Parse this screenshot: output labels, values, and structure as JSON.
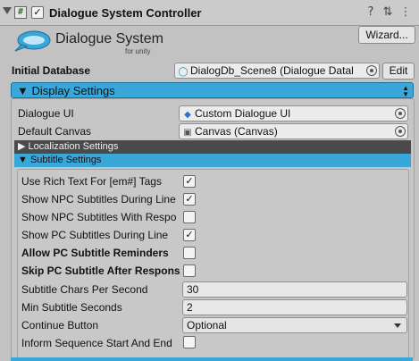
{
  "component": {
    "title": "Dialogue System Controller",
    "script_icon_glyph": "#",
    "enabled_check": "✓",
    "help_icon_glyph": "?",
    "settings_icon_glyph": "⇅",
    "menu_icon_glyph": "⋮"
  },
  "logo": {
    "title": "Dialogue System",
    "subtitle": "for unity"
  },
  "wizard_label": "Wizard...",
  "initial_database": {
    "label": "Initial Database",
    "value": "DialogDb_Scene8 (Dialogue Datal",
    "edit_label": "Edit"
  },
  "display_settings": {
    "label": "▼ Display Settings",
    "dialogue_ui": {
      "label": "Dialogue UI",
      "value": "Custom Dialogue UI"
    },
    "default_canvas": {
      "label": "Default Canvas",
      "value": "Canvas (Canvas)"
    },
    "localization_label": "▶ Localization Settings",
    "subtitle_label": "▼ Subtitle Settings"
  },
  "subtitle_settings": {
    "rows": [
      {
        "label": "Use Rich Text For [em#] Tags",
        "check": "✓",
        "bold": false
      },
      {
        "label": "Show NPC Subtitles During Line",
        "check": "✓",
        "bold": false
      },
      {
        "label": "Show NPC Subtitles With Respo",
        "check": "",
        "bold": false
      },
      {
        "label": "Show PC Subtitles During Line",
        "check": "✓",
        "bold": false
      },
      {
        "label": "Allow PC Subtitle Reminders",
        "check": "",
        "bold": true
      },
      {
        "label": "Skip PC Subtitle After Respons",
        "check": "",
        "bold": true
      }
    ],
    "chars_per_second": {
      "label": "Subtitle Chars Per Second",
      "value": "30"
    },
    "min_seconds": {
      "label": "Min Subtitle Seconds",
      "value": "2"
    },
    "continue_button": {
      "label": "Continue Button",
      "value": "Optional"
    },
    "inform_sequence": {
      "label": "Inform Sequence Start And End",
      "check": ""
    }
  },
  "colors": {
    "accent": "#3aa7d9",
    "panel": "#c2c2c2",
    "dark_bar": "#4a4a4a"
  }
}
